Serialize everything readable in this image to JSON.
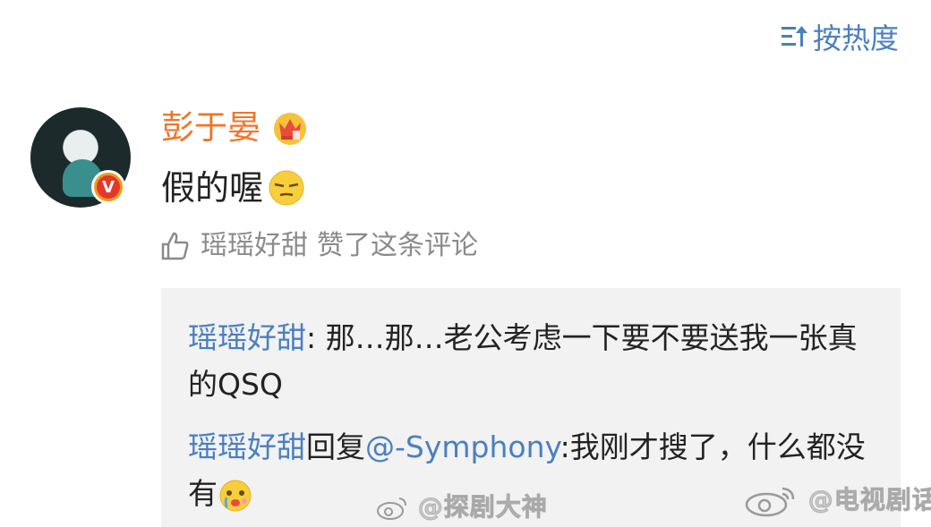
{
  "sort": {
    "label": "按热度"
  },
  "post": {
    "username": "彭于晏",
    "avatar_badge": "V",
    "comment_text": "假的喔",
    "like_user": "瑶瑶好甜",
    "like_text": "赞了这条评论"
  },
  "replies": [
    {
      "user": "瑶瑶好甜",
      "sep": ":",
      "text": " 那…那…老公考虑一下要不要送我一张真的QSQ"
    },
    {
      "user": "瑶瑶好甜",
      "reply_word": "回复",
      "at": "@-Symphony",
      "text": ":我刚才搜了，什么都没有"
    }
  ],
  "watermarks": {
    "left": "@探剧大神",
    "right": "@电视剧话"
  },
  "colors": {
    "link_blue": "#4a7fc0",
    "username_orange": "#f07427",
    "reply_bg": "#f2f2f2"
  },
  "icons": [
    "sort-icon",
    "crown-badge-icon",
    "verified-badge-icon",
    "squint-emoji-icon",
    "thumbs-up-icon",
    "tearful-emoji-icon",
    "weibo-logo-icon"
  ]
}
